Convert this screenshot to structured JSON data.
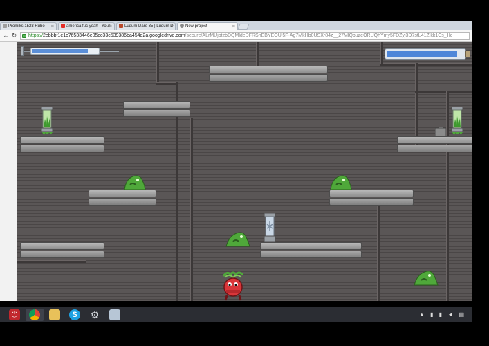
{
  "browser": {
    "tabs": [
      {
        "label": "Promiks 1528 Rubo",
        "favicon_color": "#9e9e9e"
      },
      {
        "label": "america fuc yeah - YouT",
        "favicon_color": "#e52d27"
      },
      {
        "label": "Ludum Dare 35 | Ludum D",
        "favicon_color": "#b94a2c"
      },
      {
        "label": "New project",
        "favicon_color": "#8a8a8a"
      }
    ],
    "active_tab": 3,
    "url_scheme": "https://",
    "url_host": "2ebbbf1e1c76533446e05cc33c539386ba454d2a.googledrive.com",
    "url_path": "/secure/ALrMUjptzbDQMldeDFRSnEBYEOUi5F-Ag7MkHb0USXr84z__27MlQbuzeORUQhYmy5FDZyj3D7stL41Zlkk1Cs_Hc"
  },
  "game": {
    "player_health": 0.84,
    "weapon_charge": 0.92,
    "colors": {
      "slime": "#4fa83a",
      "player": "#d9363a",
      "capsule_fluid": "#8ad24f"
    }
  },
  "taskbar": {
    "apps": [
      "power-icon",
      "chrome-icon",
      "file-explorer-icon",
      "skype-icon",
      "settings-icon",
      "notepad-icon"
    ],
    "tray_text": "▲ ▮ ▮ ◄ ▤"
  }
}
